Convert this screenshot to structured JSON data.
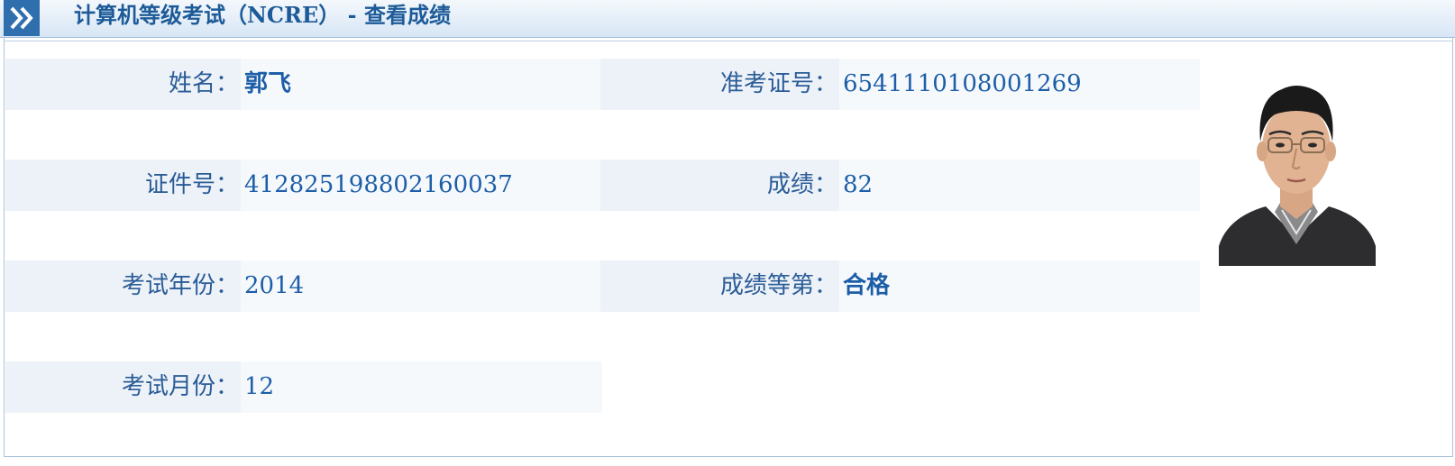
{
  "header": {
    "title": "计算机等级考试（NCRE） - 查看成绩",
    "icon": "double-chevron-right-icon"
  },
  "fields": {
    "name_label": "姓名：",
    "name_value": "郭飞",
    "admission_label": "准考证号：",
    "admission_value": "6541110108001269",
    "id_label": "证件号：",
    "id_value": "412825198802160037",
    "score_label": "成绩：",
    "score_value": "82",
    "year_label": "考试年份：",
    "year_value": "2014",
    "grade_label": "成绩等第：",
    "grade_value": "合格",
    "month_label": "考试月份：",
    "month_value": "12"
  },
  "photo": {
    "icon": "candidate-photo"
  },
  "colors": {
    "header_bg": "#d7e6f5",
    "icon_bg": "#2f6fae",
    "title_text": "#1d5b98",
    "label_bg": "#edf2f8",
    "value_bg": "#f6f9fc",
    "value_text": "#1d5ea8"
  }
}
